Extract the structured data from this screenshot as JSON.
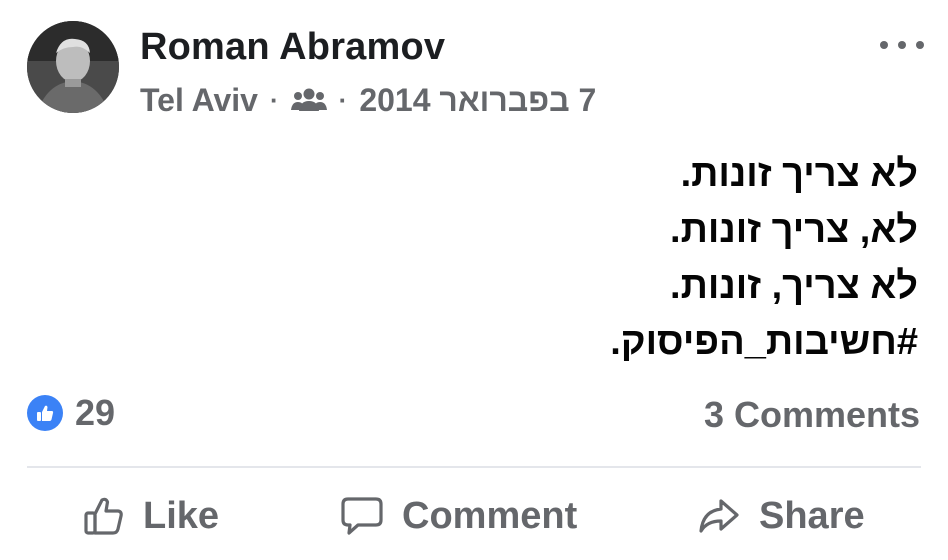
{
  "post": {
    "author": "Roman Abramov",
    "location": "Tel Aviv",
    "separator": "·",
    "date": "7 בפברואר 2014",
    "audience_icon": "friends-icon",
    "more_icon": "more-options-icon",
    "text_lines": [
      "לא צריך זונות.",
      "לא, צריך זונות.",
      "לא צריך, זונות.",
      "#חשיבות_הפיסוק."
    ]
  },
  "stats": {
    "like_icon": "like-icon",
    "likes": "29",
    "comments": "3 Comments"
  },
  "actions": {
    "like": "Like",
    "comment": "Comment",
    "share": "Share"
  },
  "colors": {
    "accent": "#3b82f6",
    "muted_text": "#65676b",
    "text": "#050505"
  }
}
